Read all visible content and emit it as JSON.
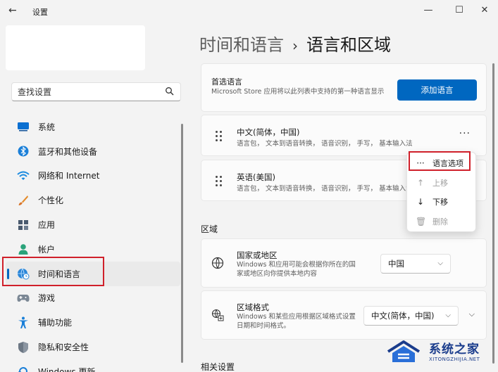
{
  "window": {
    "title": "设置",
    "back": "←",
    "minimize": "—",
    "maximize": "☐",
    "close": "✕"
  },
  "search": {
    "placeholder": "查找设置"
  },
  "sidebar": {
    "items": [
      {
        "label": "系统",
        "icon": "monitor-icon"
      },
      {
        "label": "蓝牙和其他设备",
        "icon": "bluetooth-icon"
      },
      {
        "label": "网络和 Internet",
        "icon": "wifi-icon"
      },
      {
        "label": "个性化",
        "icon": "brush-icon"
      },
      {
        "label": "应用",
        "icon": "apps-icon"
      },
      {
        "label": "帐户",
        "icon": "person-icon"
      },
      {
        "label": "时间和语言",
        "icon": "globe-clock-icon",
        "active": true
      },
      {
        "label": "游戏",
        "icon": "gamepad-icon"
      },
      {
        "label": "辅助功能",
        "icon": "accessibility-icon"
      },
      {
        "label": "隐私和安全性",
        "icon": "shield-icon"
      },
      {
        "label": "Windows 更新",
        "icon": "update-icon"
      }
    ]
  },
  "header": {
    "parent": "时间和语言",
    "separator": "›",
    "current": "语言和区域"
  },
  "preferred": {
    "title": "首选语言",
    "desc": "Microsoft Store 应用将以此列表中支持的第一种语言显示",
    "add_button": "添加语言"
  },
  "languages": [
    {
      "name": "中文(简体，中国)",
      "features": "语言包，  文本到语音转换，  语音识别，  手写，  基本输入法",
      "more": "···"
    },
    {
      "name": "英语(美国)",
      "features": "语言包，  文本到语音转换，  语音识别，  手写，  基本输入法"
    }
  ],
  "context_menu": {
    "items": [
      {
        "icon": "···",
        "label": "语言选项"
      },
      {
        "icon": "↑",
        "label": "上移",
        "disabled": true
      },
      {
        "icon": "↓",
        "label": "下移"
      },
      {
        "icon": "🗑",
        "label": "删除",
        "disabled": true
      }
    ]
  },
  "region": {
    "section_title": "区域",
    "country": {
      "title": "国家或地区",
      "desc": "Windows 和应用可能会根据你所在的国家或地区向你提供本地内容",
      "value": "中国"
    },
    "format": {
      "title": "区域格式",
      "desc": "Windows 和某些应用根据区域格式设置日期和时间格式。",
      "value": "中文(简体，中国)"
    }
  },
  "related": {
    "section_title": "相关设置"
  },
  "watermark": {
    "name": "系统之家",
    "url": "XITONGZHIJIA.NET"
  },
  "colors": {
    "accent": "#0067c0",
    "highlight": "#d0202a"
  }
}
